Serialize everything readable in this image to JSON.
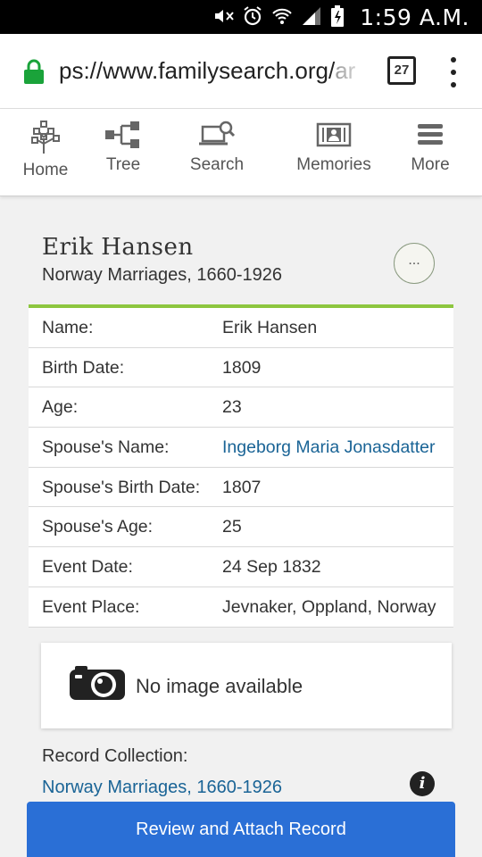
{
  "status_bar": {
    "time": "1:59 A.M.",
    "icons": [
      "mute-icon",
      "alarm-icon",
      "wifi-icon",
      "signal-icon",
      "battery-icon"
    ]
  },
  "browser": {
    "url_prefix": "ps://www.familysearch.org/",
    "url_faded": "ar",
    "tab_count": "27"
  },
  "nav": {
    "items": [
      {
        "label": "Home",
        "icon": "tree-home-icon"
      },
      {
        "label": "Tree",
        "icon": "tree-chart-icon"
      },
      {
        "label": "Search",
        "icon": "search-laptop-icon"
      },
      {
        "label": "Memories",
        "icon": "memories-icon"
      },
      {
        "label": "More",
        "icon": "menu-icon"
      }
    ]
  },
  "record": {
    "name": "Erik Hansen",
    "collection": "Norway Marriages, 1660-1926",
    "more_label": "...",
    "fields": [
      {
        "label": "Name:",
        "value": "Erik Hansen"
      },
      {
        "label": "Birth Date:",
        "value": "1809"
      },
      {
        "label": "Age:",
        "value": "23"
      },
      {
        "label": "Spouse's Name:",
        "value": "Ingeborg Maria Jonasdatter"
      },
      {
        "label": "Spouse's Birth Date:",
        "value": "1807"
      },
      {
        "label": "Spouse's Age:",
        "value": "25"
      },
      {
        "label": "Event Date:",
        "value": "24 Sep 1832"
      },
      {
        "label": "Event Place:",
        "value": "Jevnaker, Oppland, Norway"
      }
    ],
    "no_image_text": "No image available",
    "record_collection_label": "Record Collection:",
    "record_collection_link": "Norway Marriages, 1660-1926",
    "info_glyph": "i",
    "cta_label": "Review and Attach Record"
  },
  "colors": {
    "accent_green": "#8dc63f",
    "link_blue": "#1a6496",
    "button_blue": "#2a6fd6"
  }
}
